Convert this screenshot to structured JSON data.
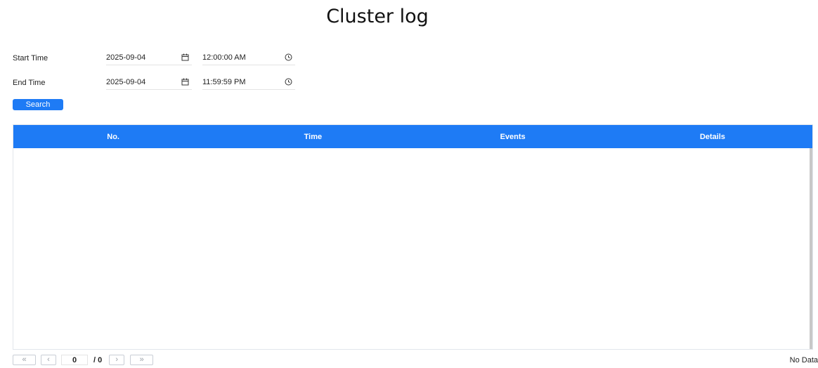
{
  "page": {
    "title": "Cluster log"
  },
  "filters": {
    "start": {
      "label": "Start Time",
      "date": "2025-09-04",
      "time": "12:00:00 AM"
    },
    "end": {
      "label": "End Time",
      "date": "2025-09-04",
      "time": "11:59:59 PM"
    },
    "search_label": "Search"
  },
  "table": {
    "columns": [
      "No.",
      "Time",
      "Events",
      "Details"
    ],
    "rows": []
  },
  "pagination": {
    "first_label": "«",
    "prev_label": "‹",
    "current_page": "0",
    "total_label": "/ 0",
    "next_label": "›",
    "last_label": "»",
    "status": "No Data"
  },
  "colors": {
    "accent": "#1e7bf5",
    "header_text": "#ffffff"
  },
  "icons": {
    "date": "calendar-icon",
    "time": "clock-icon"
  }
}
